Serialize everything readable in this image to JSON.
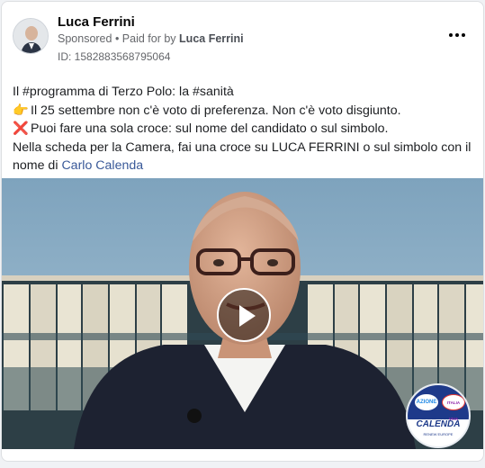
{
  "post": {
    "author": "Luca Ferrini",
    "sponsored": "Sponsored",
    "paid_prefix": "• Paid for by",
    "paid_by": "Luca Ferrini",
    "ad_id": "ID: 1582883568795064",
    "more_icon": "more-horizontal-icon"
  },
  "body": {
    "line1": "Il #programma di Terzo Polo: la #sanità",
    "line2_emoji": "👉",
    "line2": "Il 25 settembre non c'è voto di preferenza. Non c'è voto disgiunto.",
    "line3_emoji": "❌",
    "line3": "Puoi fare una sola croce: sul nome del candidato o sul simbolo.",
    "line4": "Nella scheda per la Camera, fai una croce su LUCA FERRINI o sul simbolo con il",
    "line5_prefix": "nome di",
    "line5_link": "Carlo Calenda"
  },
  "video": {
    "play_icon": "play-icon"
  },
  "logo": {
    "left_badge": "AZIONE",
    "right_badge": "ITALIA VIVA",
    "name": "CALENDA",
    "sub": "RENEW EUROPE"
  },
  "colors": {
    "link": "#385898",
    "logo_blue": "#1e3a8a",
    "x_red": "#e0245e"
  }
}
